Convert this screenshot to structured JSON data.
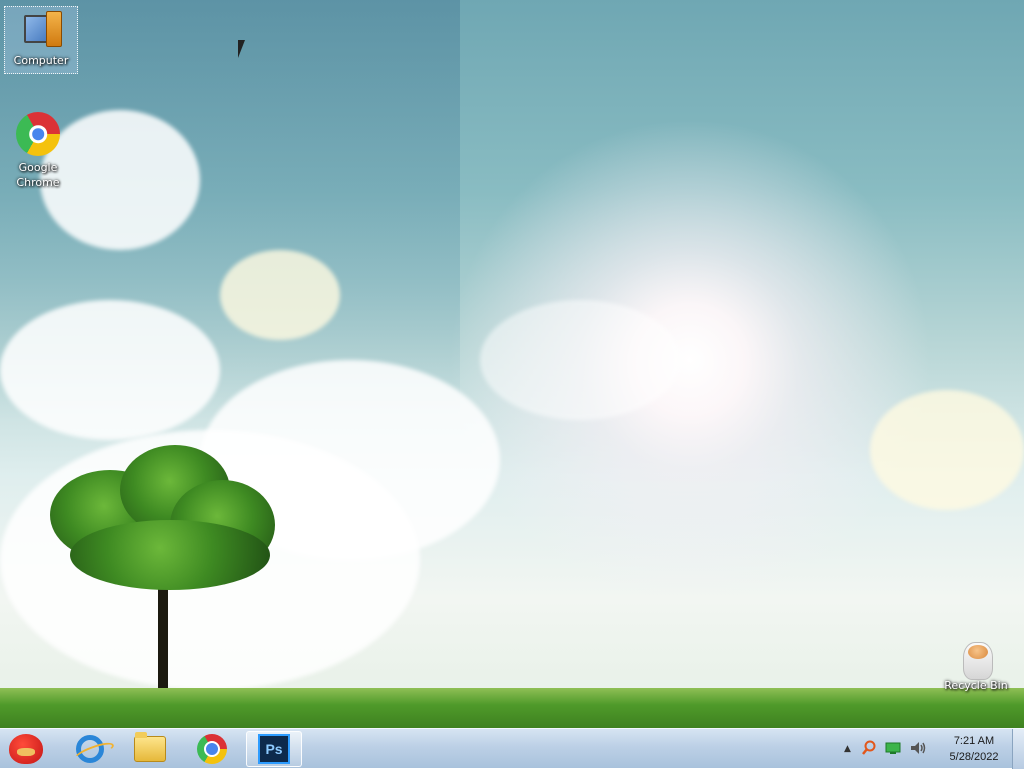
{
  "desktop": {
    "icons": [
      {
        "label": "Computer",
        "icon": "computer-icon"
      },
      {
        "label": "Google\nChrome",
        "icon": "chrome-icon"
      },
      {
        "label": "Recycle Bin",
        "icon": "recycle-bin-icon"
      }
    ]
  },
  "taskbar": {
    "start_button": {
      "icon": "angry-birds-icon"
    },
    "pinned": [
      {
        "icon": "internet-explorer-icon"
      },
      {
        "icon": "windows-explorer-icon"
      },
      {
        "icon": "google-chrome-icon"
      },
      {
        "icon": "photoshop-icon",
        "text": "Ps",
        "active": true
      }
    ],
    "tray": {
      "icons": [
        "show-hidden-icons-icon",
        "search-icon",
        "network-icon",
        "volume-icon"
      ],
      "time": "7:21 AM",
      "date": "5/28/2022"
    }
  },
  "colors": {
    "taskbar": "#bcd0e6",
    "sky": "#89bcc2",
    "grass": "#4f9a2a"
  }
}
